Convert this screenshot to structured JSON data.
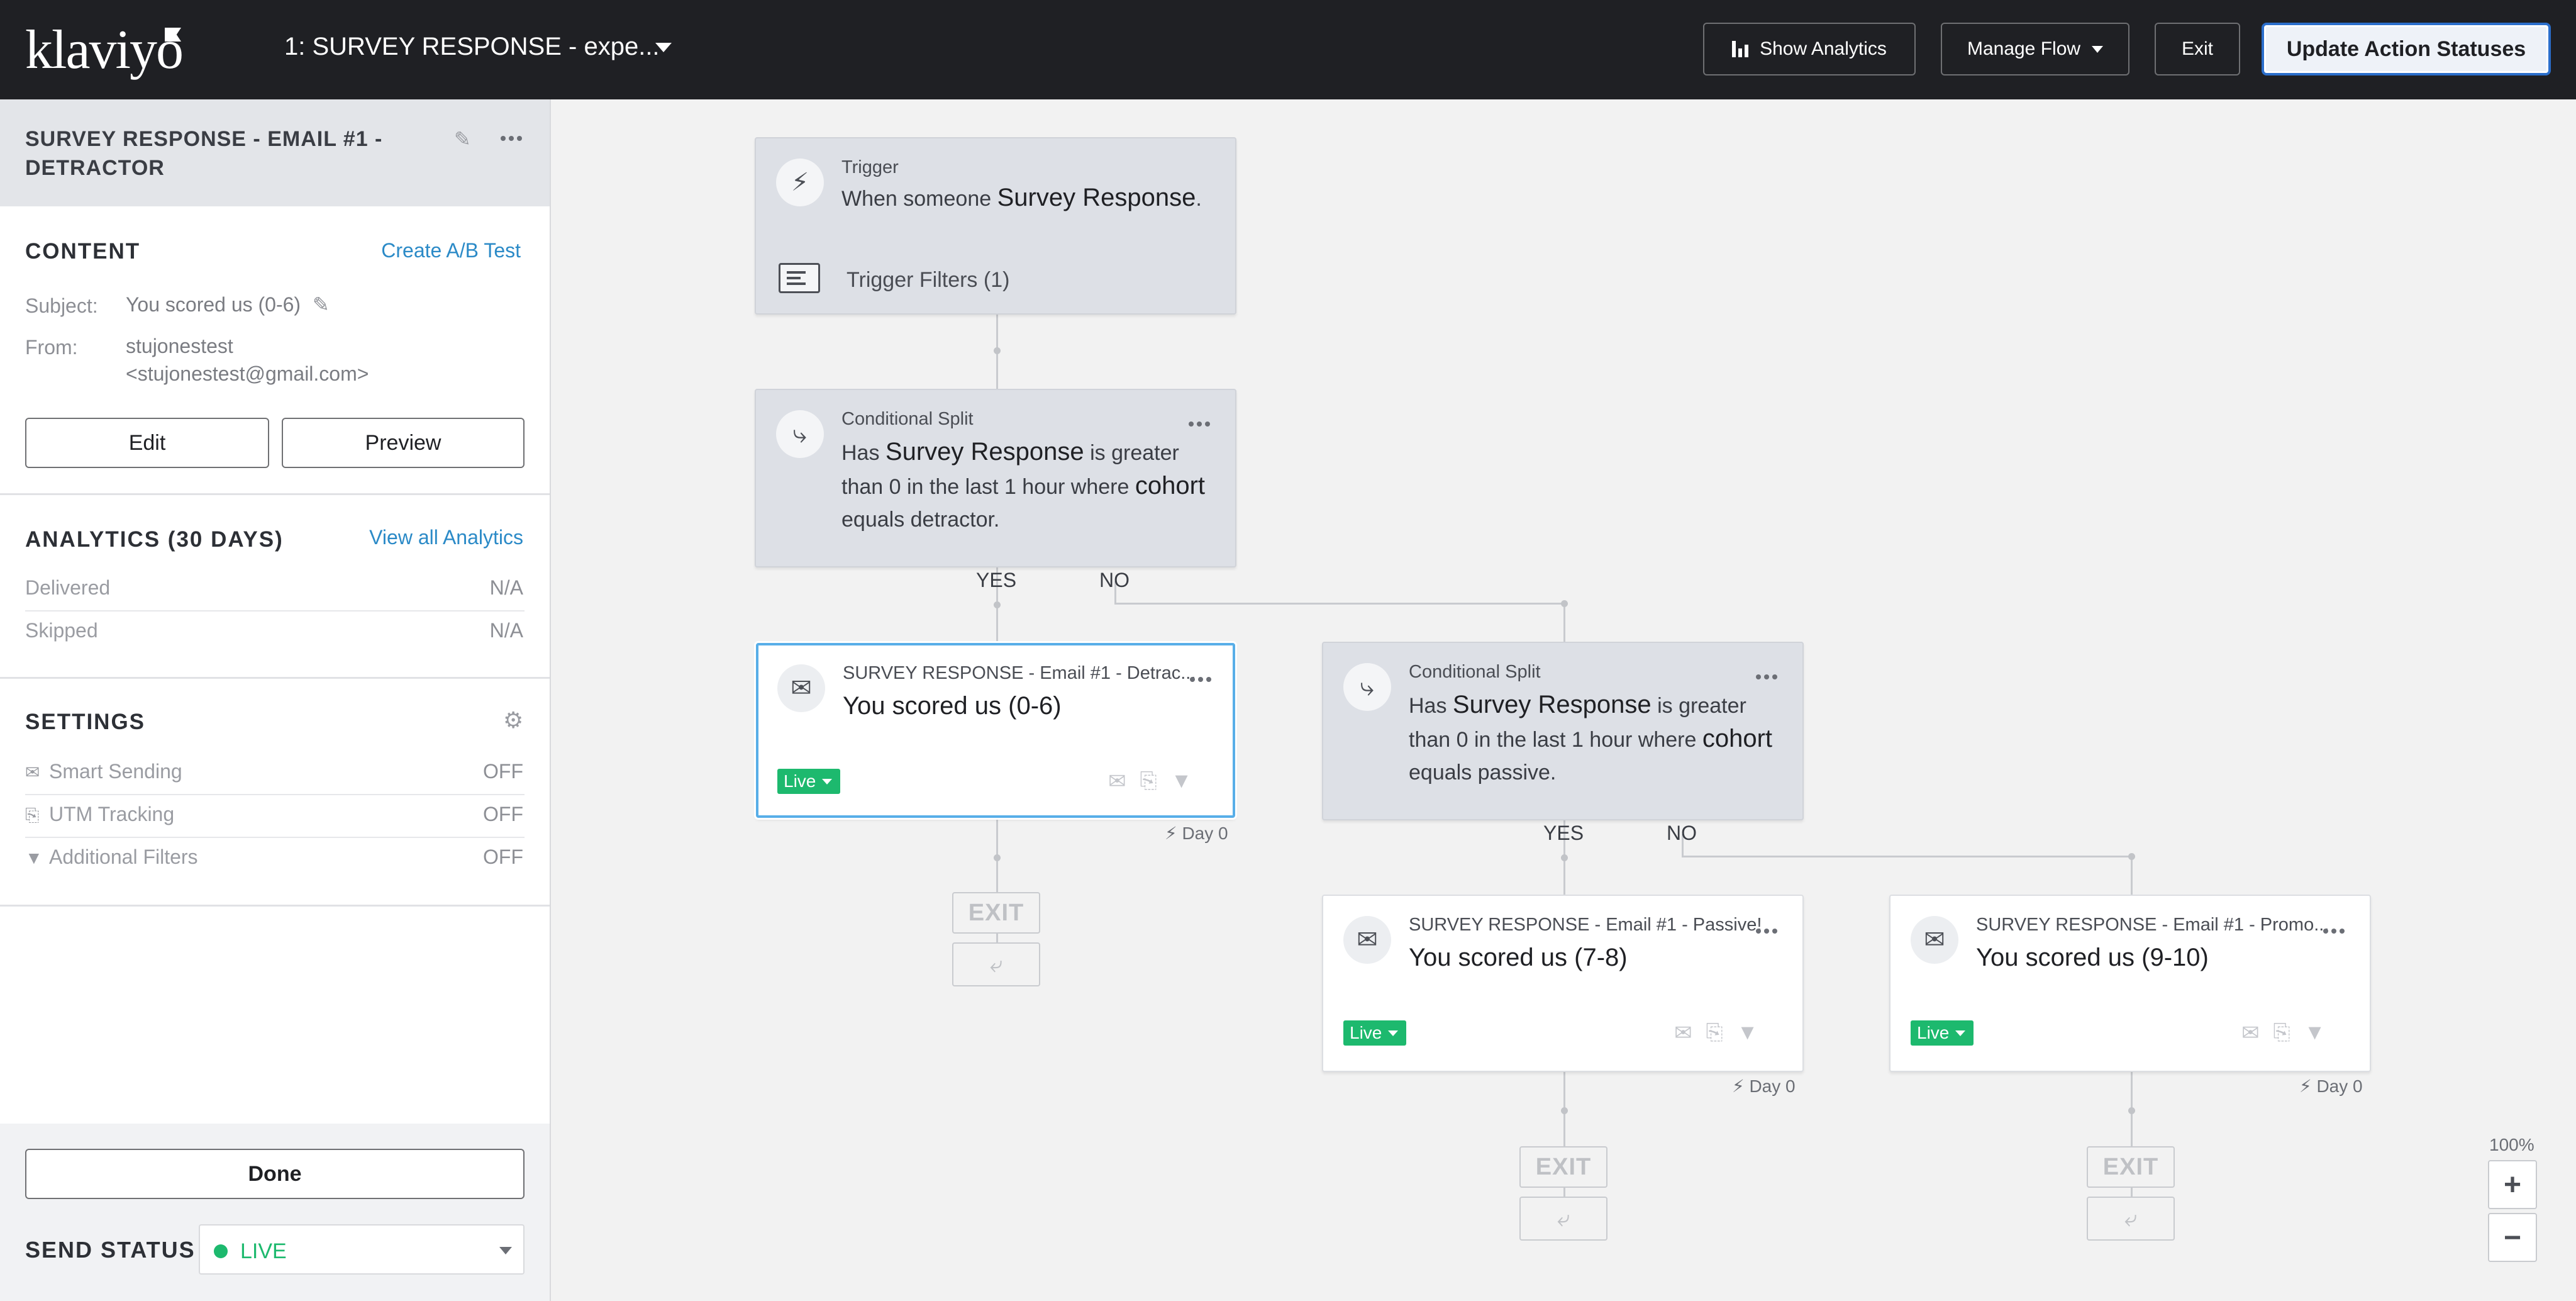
{
  "topbar": {
    "logo": "klaviyo",
    "flow_title": "1: SURVEY RESPONSE - expe...",
    "show_analytics": "Show Analytics",
    "manage_flow": "Manage Flow",
    "exit": "Exit",
    "update_statuses": "Update Action Statuses"
  },
  "sidebar": {
    "title": "SURVEY RESPONSE - EMAIL #1 - DETRACTOR",
    "content": {
      "heading": "CONTENT",
      "ab_test_link": "Create A/B Test",
      "subject_label": "Subject:",
      "subject_value": "You scored us (0-6)",
      "from_label": "From:",
      "from_name": "stujonestest",
      "from_email": "<stujonestest@gmail.com>",
      "edit": "Edit",
      "preview": "Preview"
    },
    "analytics": {
      "heading": "ANALYTICS (30 DAYS)",
      "view_all": "View all Analytics",
      "rows": [
        {
          "label": "Delivered",
          "value": "N/A"
        },
        {
          "label": "Skipped",
          "value": "N/A"
        }
      ]
    },
    "settings": {
      "heading": "SETTINGS",
      "rows": [
        {
          "label": "Smart Sending",
          "value": "OFF",
          "icon": "smart-sending-icon"
        },
        {
          "label": "UTM Tracking",
          "value": "OFF",
          "icon": "utm-tracking-icon"
        },
        {
          "label": "Additional Filters",
          "value": "OFF",
          "icon": "filter-icon"
        }
      ]
    },
    "done": "Done",
    "send_status_label": "SEND STATUS",
    "send_status_value": "LIVE"
  },
  "canvas": {
    "trigger": {
      "type": "Trigger",
      "text_pre": "When someone ",
      "text_em": "Survey Response",
      "text_post": ".",
      "filters": "Trigger Filters (1)"
    },
    "split1": {
      "type": "Conditional Split",
      "t1": "Has ",
      "e1": "Survey Response",
      "t2": " is greater than 0 in the last 1 hour where ",
      "e2": "cohort",
      "t3": " equals detractor."
    },
    "split2": {
      "type": "Conditional Split",
      "t1": "Has ",
      "e1": "Survey Response",
      "t2": " is greater than 0 in the last 1 hour where ",
      "e2": "cohort",
      "t3": " equals passive."
    },
    "yes": "YES",
    "no": "NO",
    "emails": [
      {
        "name": "SURVEY RESPONSE - Email #1 - Detrac...",
        "subject": "You scored us (0-6)",
        "status": "Live",
        "day": "Day 0"
      },
      {
        "name": "SURVEY RESPONSE - Email #1 - Passive!",
        "subject": "You scored us (7-8)",
        "status": "Live",
        "day": "Day 0"
      },
      {
        "name": "SURVEY RESPONSE - Email #1 - Promo...",
        "subject": "You scored us (9-10)",
        "status": "Live",
        "day": "Day 0"
      }
    ],
    "exit_label": "EXIT",
    "zoom_level": "100%",
    "zoom_in": "+",
    "zoom_out": "−"
  },
  "colors": {
    "topbar_bg": "#1f2024",
    "accent_link": "#2b8ac7",
    "live_green": "#1db96e",
    "selected_border": "#58aee8"
  }
}
